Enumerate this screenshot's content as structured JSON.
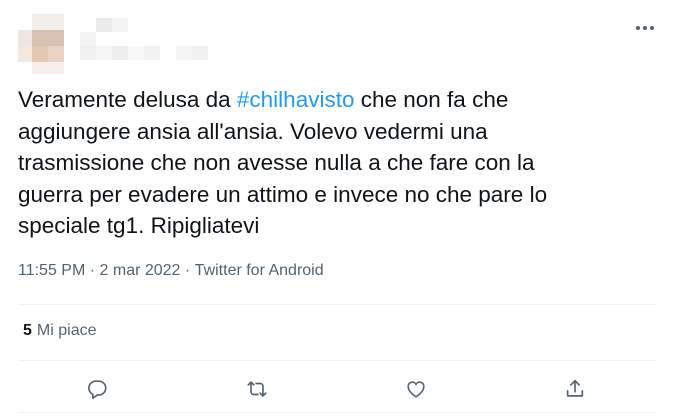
{
  "tweet": {
    "text_before": "Veramente delusa da ",
    "hashtag": "#chilhavisto",
    "text_after": " che non fa che\naggiungere ansia all'ansia. Volevo vedermi una\ntrasmissione che non avesse nulla a che fare con la\nguerra per evadere un attimo e invece no che pare lo\nspeciale tg1. Ripigliatevi",
    "time": "11:55 PM",
    "separator": " · ",
    "date": "2 mar 2022",
    "source": "Twitter for Android"
  },
  "stats": {
    "likes_count": "5",
    "likes_label": "Mi piace"
  },
  "icons": {
    "more": "more-horizontal-icon",
    "reply": "reply-icon",
    "retweet": "retweet-icon",
    "like": "heart-icon",
    "share": "share-icon"
  },
  "colors": {
    "hashtag": "#1d9bf0",
    "secondary_text": "#536471",
    "primary_text": "#0f1419"
  }
}
